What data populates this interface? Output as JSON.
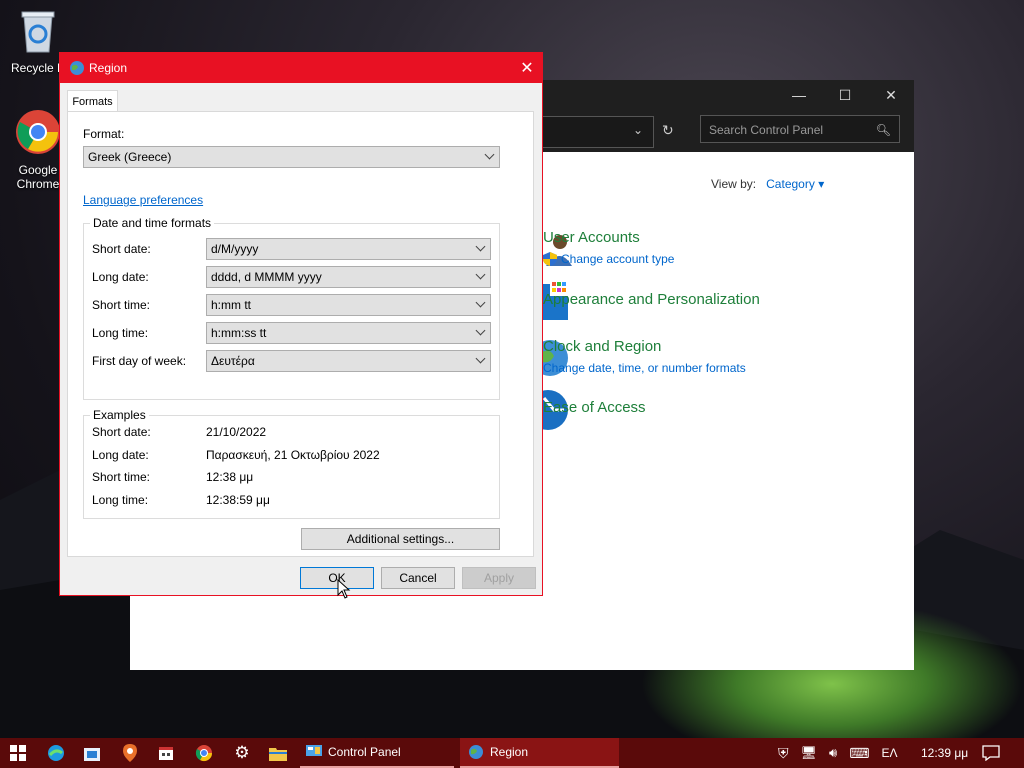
{
  "desktop": {
    "recycle_label": "Recycle B",
    "chrome_label_1": "Google",
    "chrome_label_2": "Chrome"
  },
  "control_panel": {
    "search_placeholder": "Search Control Panel",
    "view_by_label": "View by:",
    "view_by_value": "Category",
    "categories": [
      {
        "title": "User Accounts",
        "link": "Change account type"
      },
      {
        "title": "Appearance and Personalization",
        "link": ""
      },
      {
        "title": "Clock and Region",
        "link": "Change date, time, or number formats"
      },
      {
        "title": "Ease of Access",
        "link": ""
      }
    ]
  },
  "dialog": {
    "title": "Region",
    "tab": "Formats",
    "format_label": "Format:",
    "format_value": "Greek (Greece)",
    "language_link": "Language preferences",
    "dt_group": "Date and time formats",
    "fields": [
      {
        "label": "Short date:",
        "value": "d/M/yyyy"
      },
      {
        "label": "Long date:",
        "value": "dddd, d MMMM yyyy"
      },
      {
        "label": "Short time:",
        "value": "h:mm tt"
      },
      {
        "label": "Long time:",
        "value": "h:mm:ss tt"
      },
      {
        "label": "First day of week:",
        "value": "Δευτέρα"
      }
    ],
    "examples_group": "Examples",
    "examples": [
      {
        "label": "Short date:",
        "value": "21/10/2022"
      },
      {
        "label": "Long date:",
        "value": "Παρασκευή, 21 Οκτωβρίου 2022"
      },
      {
        "label": "Short time:",
        "value": "12:38 μμ"
      },
      {
        "label": "Long time:",
        "value": "12:38:59 μμ"
      }
    ],
    "additional_settings": "Additional settings...",
    "ok": "OK",
    "cancel": "Cancel",
    "apply": "Apply"
  },
  "taskbar": {
    "apps": [
      {
        "label": "Control Panel"
      },
      {
        "label": "Region"
      }
    ],
    "language": "ΕΛ",
    "time": "12:39 μμ"
  },
  "colors": {
    "dialog_accent": "#e81123",
    "taskbar": "#5a0a0a",
    "link": "#0066cc",
    "category_title": "#1e7f3a"
  }
}
